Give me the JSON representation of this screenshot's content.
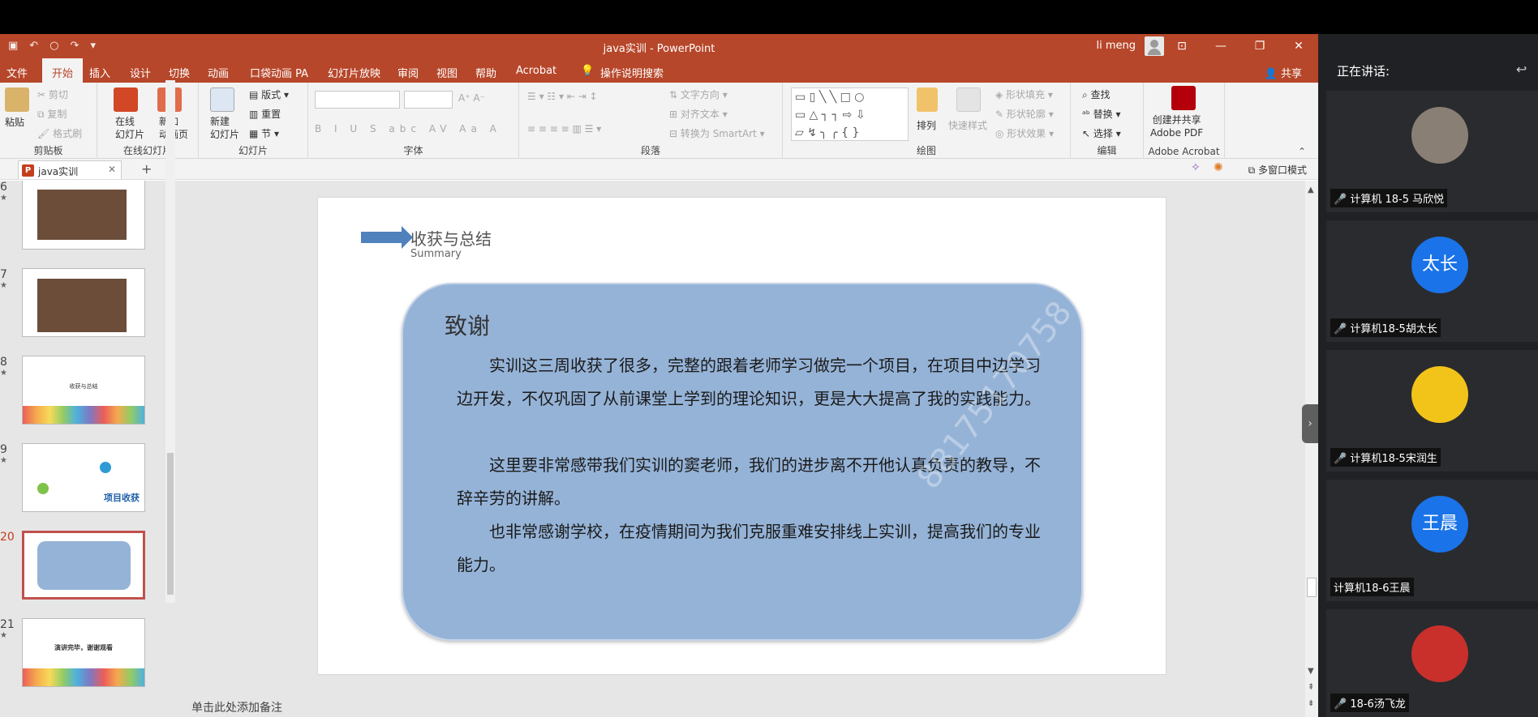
{
  "window": {
    "title": "java实训 - PowerPoint",
    "user": "li meng"
  },
  "tabs": [
    "文件",
    "开始",
    "插入",
    "设计",
    "切换",
    "动画",
    "口袋动画 PA",
    "幻灯片放映",
    "审阅",
    "视图",
    "帮助",
    "Acrobat"
  ],
  "active_tab": "开始",
  "tell_me": "操作说明搜索",
  "share": "共享",
  "ribbon": {
    "clipboard": {
      "paste": "粘贴",
      "cut": "剪切",
      "copy": "复制",
      "format_painter": "格式刷",
      "label": "剪贴板"
    },
    "online": {
      "online_slides": "在线\n幻灯片",
      "new_anim_page": "新加\n动画页",
      "label": "在线幻灯片"
    },
    "slides": {
      "new_slide": "新建\n幻灯片",
      "layout": "版式",
      "reset": "重置",
      "section": "节",
      "label": "幻灯片"
    },
    "font": {
      "label": "字体"
    },
    "paragraph": {
      "text_direction": "文字方向",
      "align_text": "对齐文本",
      "smartart": "转换为 SmartArt",
      "label": "段落"
    },
    "drawing": {
      "arrange": "排列",
      "quick_styles": "快速样式",
      "shape_fill": "形状填充",
      "shape_outline": "形状轮廓",
      "shape_effects": "形状效果",
      "label": "绘图"
    },
    "editing": {
      "find": "查找",
      "replace": "替换",
      "select": "选择",
      "label": "编辑"
    },
    "acrobat": {
      "create_share": "创建并共享\nAdobe PDF",
      "label": "Adobe Acrobat"
    }
  },
  "doc_tab": "java实训",
  "multi_window": "多窗口模式",
  "thumbnails": [
    {
      "num": "6",
      "type": "screen"
    },
    {
      "num": "7",
      "type": "screen"
    },
    {
      "num": "8",
      "type": "title",
      "text": "收获与总结"
    },
    {
      "num": "9",
      "type": "harvest",
      "text": "项目收获"
    },
    {
      "num": "20",
      "type": "current"
    },
    {
      "num": "21",
      "type": "end",
      "text": "演讲完毕，谢谢观看"
    }
  ],
  "slide": {
    "title": "收获与总结",
    "subtitle": "Summary",
    "heading": "致谢",
    "paragraphs": [
      "　　实训这三周收获了很多，完整的跟着老师学习做完一个项目，在项目中边学习边开发，不仅巩固了从前课堂上学到的理论知识，更是大大提高了我的实践能力。",
      "　　这里要非常感带我们实训的窦老师，我们的进步离不开他认真负责的教导，不辞辛劳的讲解。",
      "　　也非常感谢学校，在疫情期间为我们克服重难安排线上实训，提高我们的专业能力。"
    ],
    "watermark": "88175170758 gtfrank"
  },
  "notes_placeholder": "单击此处添加备注",
  "meeting": {
    "speaking_label": "正在讲话:",
    "participants": [
      {
        "name": "计算机 18-5  马欣悦",
        "avatar_text": "",
        "avatar_color": "#8a7f74"
      },
      {
        "name": "计算机18-5胡太长",
        "avatar_text": "太长",
        "avatar_color": "#1a73e8"
      },
      {
        "name": "计算机18-5宋润生",
        "avatar_text": "",
        "avatar_color": "#f2c318"
      },
      {
        "name": "计算机18-6王晨",
        "avatar_text": "王晨",
        "avatar_color": "#1a73e8"
      },
      {
        "name": "18-6汤飞龙",
        "avatar_text": "",
        "avatar_color": "#c9302c"
      }
    ]
  }
}
